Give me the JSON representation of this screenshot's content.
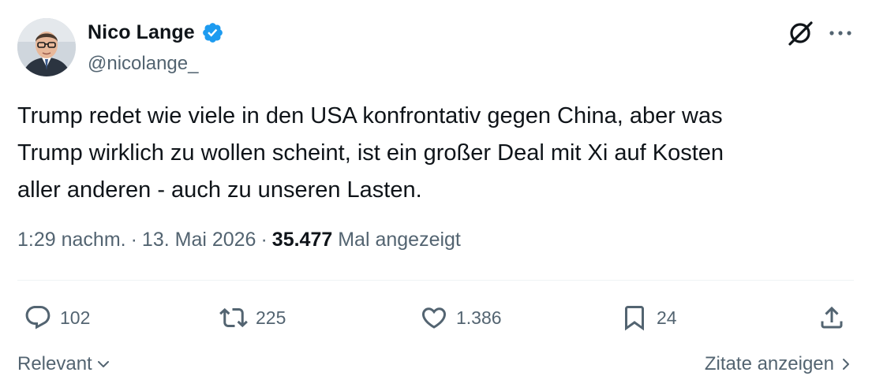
{
  "author": {
    "name": "Nico Lange",
    "handle": "@nicolange_",
    "verified": true
  },
  "tweet": {
    "text": "Trump redet wie viele in den USA konfrontativ gegen China, aber was\nTrump wirklich zu wollen scheint, ist ein großer Deal mit Xi auf Kosten\naller anderen - auch zu unseren Lasten."
  },
  "meta": {
    "time": "1:29 nachm.",
    "separator": "·",
    "date": "13. Mai 2026",
    "views_count": "35.477",
    "views_label": "Mal angezeigt"
  },
  "actions": {
    "replies": "102",
    "retweets": "225",
    "likes": "1.386",
    "bookmarks": "24"
  },
  "footer": {
    "sort_label": "Relevant",
    "quotes_label": "Zitate anzeigen"
  },
  "icons": {
    "verified": "verified-badge-icon",
    "grok": "grok-icon",
    "more": "more-icon",
    "reply": "reply-icon",
    "retweet": "retweet-icon",
    "like": "like-icon",
    "bookmark": "bookmark-icon",
    "share": "share-icon"
  },
  "colors": {
    "text_primary": "#0f1419",
    "text_secondary": "#536471",
    "verified_blue": "#1d9bf0",
    "divider": "#eff3f4"
  }
}
